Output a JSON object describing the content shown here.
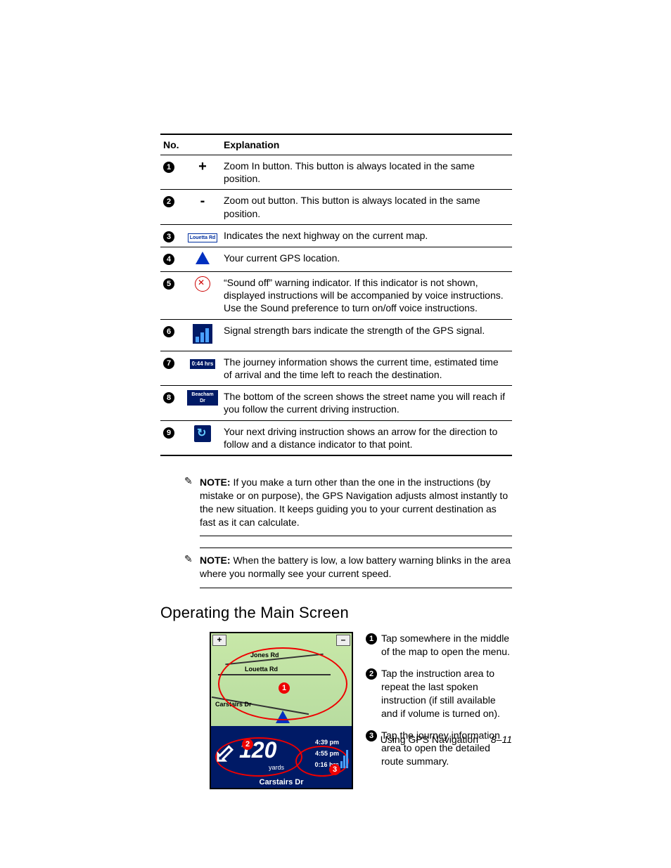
{
  "table": {
    "headers": {
      "no": "No.",
      "explanation": "Explanation"
    },
    "rows": [
      {
        "num": "1",
        "icon": "plus",
        "icon_text": "+",
        "text": "Zoom In button. This button is always located in the same position."
      },
      {
        "num": "2",
        "icon": "minus",
        "icon_text": "-",
        "text": "Zoom out button. This button is always located in the same position."
      },
      {
        "num": "3",
        "icon": "highway",
        "icon_text": "Louetta Rd",
        "text": "Indicates the next highway on the current map."
      },
      {
        "num": "4",
        "icon": "gps",
        "icon_text": "",
        "text": "Your current GPS location."
      },
      {
        "num": "5",
        "icon": "soundoff",
        "icon_text": "",
        "text": "“Sound off” warning indicator. If this indicator is not shown, displayed instructions will be accompanied by voice instructions. Use the Sound preference to turn on/off voice instructions."
      },
      {
        "num": "6",
        "icon": "signal",
        "icon_text": "",
        "text": "Signal strength bars indicate the strength of the GPS signal."
      },
      {
        "num": "7",
        "icon": "time",
        "icon_text": "0:44 hrs",
        "text": "The journey information shows the current time, estimated time of arrival and the time left to reach the destination."
      },
      {
        "num": "8",
        "icon": "street",
        "icon_text": "Beacham Dr",
        "text": "The bottom of the screen shows the street name you will reach if you follow the current driving instruction."
      },
      {
        "num": "9",
        "icon": "turn",
        "icon_text": "",
        "text": "Your next driving instruction shows an arrow for the direction to follow and a distance indicator to that point."
      }
    ]
  },
  "notes": [
    {
      "label": "NOTE:",
      "text": " If you make a turn other than the one in the instructions (by mistake or on purpose), the GPS Navigation adjusts almost instantly to the new situation. It keeps guiding you to your current destination as fast as it can calculate."
    },
    {
      "label": "NOTE:",
      "text": " When the battery is low, a low battery warning blinks in the area where you normally see your current speed."
    }
  ],
  "section_heading": "Operating the Main Screen",
  "figure": {
    "zoom_in": "+",
    "zoom_out": "–",
    "road_labels": {
      "l1": "Jones Rd",
      "l2": "Louetta Rd",
      "l3": "Carstairs Dr"
    },
    "callouts": {
      "c1": "1",
      "c2": "2",
      "c3": "3"
    },
    "distance_value": "120",
    "distance_unit": "yards",
    "times": {
      "t1": "4:39 pm",
      "t2": "4:55 pm",
      "t3": "0:16 hrs"
    },
    "bottom_street": "Carstairs Dr"
  },
  "operating_steps": [
    {
      "num": "1",
      "text": "Tap somewhere in the middle of the map to open the menu."
    },
    {
      "num": "2",
      "text": "Tap the instruction area to repeat the last spoken instruction (if still available and if volume is turned on)."
    },
    {
      "num": "3",
      "text": "Tap the journey information area to open the detailed route summary."
    }
  ],
  "footer": {
    "title": "Using GPS Navigation",
    "page": "8–11"
  }
}
